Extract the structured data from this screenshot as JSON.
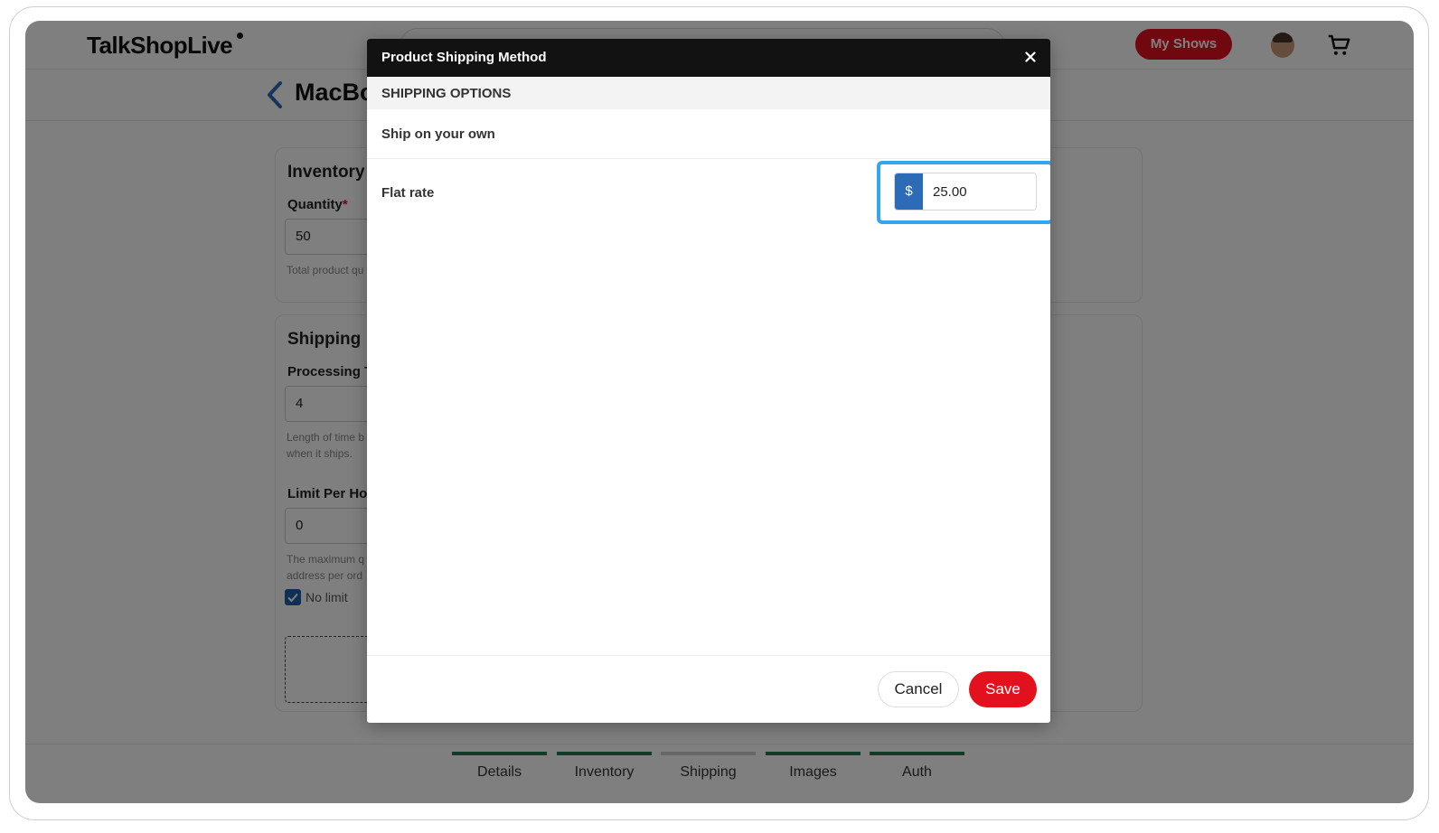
{
  "header": {
    "logo": "TalkShopLive",
    "my_shows": "My Shows"
  },
  "page": {
    "title": "MacBo"
  },
  "inventory": {
    "heading": "Inventory",
    "quantity_label": "Quantity",
    "required_mark": "*",
    "quantity_value": "50",
    "quantity_help": "Total product qu"
  },
  "shipping": {
    "heading": "Shipping",
    "processing_label": "Processing T",
    "processing_value": "4",
    "processing_help_1": "Length of time b",
    "processing_help_2": "when it ships.",
    "limit_label": "Limit Per Ho",
    "limit_value": "0",
    "limit_help_1": "The maximum q",
    "limit_help_2": "address per ord",
    "no_limit_label": "No limit"
  },
  "steps": [
    {
      "label": "Details",
      "done": true
    },
    {
      "label": "Inventory",
      "done": true
    },
    {
      "label": "Shipping",
      "done": false
    },
    {
      "label": "Images",
      "done": true
    },
    {
      "label": "Auth",
      "done": true
    }
  ],
  "modal": {
    "title": "Product Shipping Method",
    "section": "SHIPPING OPTIONS",
    "ship_own": "Ship on your own",
    "flat_rate_label": "Flat rate",
    "currency": "$",
    "flat_rate_value": "25.00",
    "cancel": "Cancel",
    "save": "Save"
  },
  "colors": {
    "brand_red": "#e3101e",
    "highlight_blue": "#32a7f0",
    "addon_blue": "#2c6bb6",
    "step_green": "#1f7a4f"
  }
}
